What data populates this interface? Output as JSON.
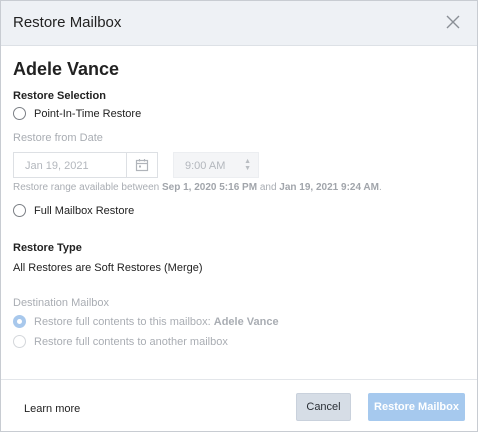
{
  "dialog": {
    "title": "Restore Mailbox",
    "user_name": "Adele Vance"
  },
  "restore_selection": {
    "label": "Restore Selection",
    "point_in_time_label": "Point-In-Time Restore",
    "restore_from_date_label": "Restore from Date",
    "date_value": "Jan 19, 2021",
    "time_value": "9:00 AM",
    "range_prefix": "Restore range available between ",
    "range_start": "Sep 1, 2020 5:16 PM",
    "range_and": " and ",
    "range_end": "Jan 19, 2021 9:24 AM",
    "range_suffix": ".",
    "full_mailbox_label": "Full Mailbox Restore"
  },
  "restore_type": {
    "label": "Restore Type",
    "value": "All Restores are Soft Restores (Merge)"
  },
  "destination": {
    "label": "Destination Mailbox",
    "option_this_prefix": "Restore full contents to this mailbox: ",
    "option_this_name": "Adele Vance",
    "option_another": "Restore full contents to another mailbox"
  },
  "footer": {
    "learn_more": "Learn more",
    "cancel": "Cancel",
    "restore": "Restore Mailbox"
  },
  "colors": {
    "primary_disabled": "#a6c9ee",
    "header_bg": "#eef1f5"
  }
}
